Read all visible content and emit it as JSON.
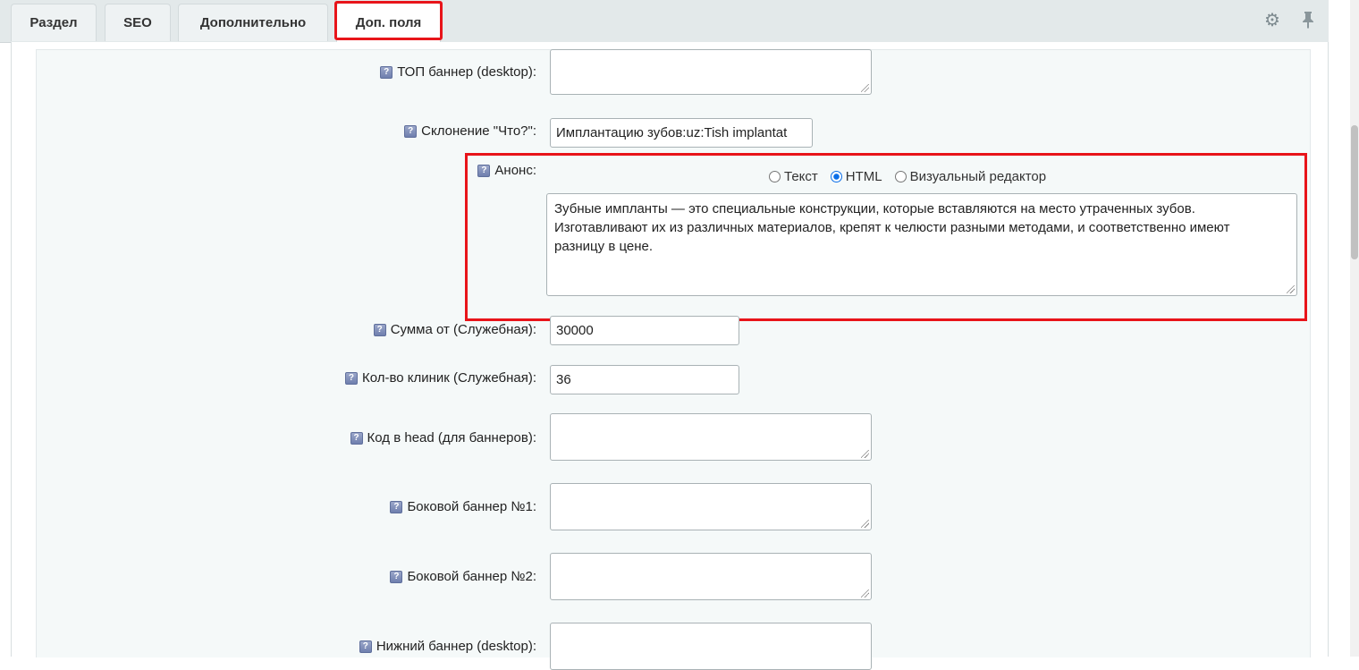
{
  "tabs": [
    {
      "label": "Раздел"
    },
    {
      "label": "SEO"
    },
    {
      "label": "Дополнительно"
    },
    {
      "label": "Доп. поля"
    }
  ],
  "toolbar": {
    "settings_icon": "gear-icon",
    "pin_icon": "pin-icon"
  },
  "fields": {
    "top_banner": {
      "label": "ТОП баннер (desktop):",
      "value": ""
    },
    "declension": {
      "label": "Склонение \"Что?\":",
      "value": "Имплантацию зубов:uz:Tish implantat"
    },
    "annons": {
      "label": "Анонс:",
      "modes": [
        "Текст",
        "HTML",
        "Визуальный редактор"
      ],
      "selected_mode": "HTML",
      "value": "Зубные импланты — это специальные конструкции, которые вставляются на место утраченных зубов.\nИзготавливают их из различных материалов, крепят к челюсти разными методами, и соответственно имеют\nразницу в цене."
    },
    "sum_from": {
      "label": "Сумма от (Служебная):",
      "value": "30000"
    },
    "clinics_count": {
      "label": "Кол-во клиник (Служебная):",
      "value": "36"
    },
    "head_code": {
      "label": "Код в head (для баннеров):",
      "value": ""
    },
    "side_banner_1": {
      "label": "Боковой баннер №1:",
      "value": ""
    },
    "side_banner_2": {
      "label": "Боковой баннер №2:",
      "value": ""
    },
    "bottom_banner": {
      "label": "Нижний баннер (desktop):",
      "value": ""
    }
  },
  "highlight_color": "#e8141a"
}
